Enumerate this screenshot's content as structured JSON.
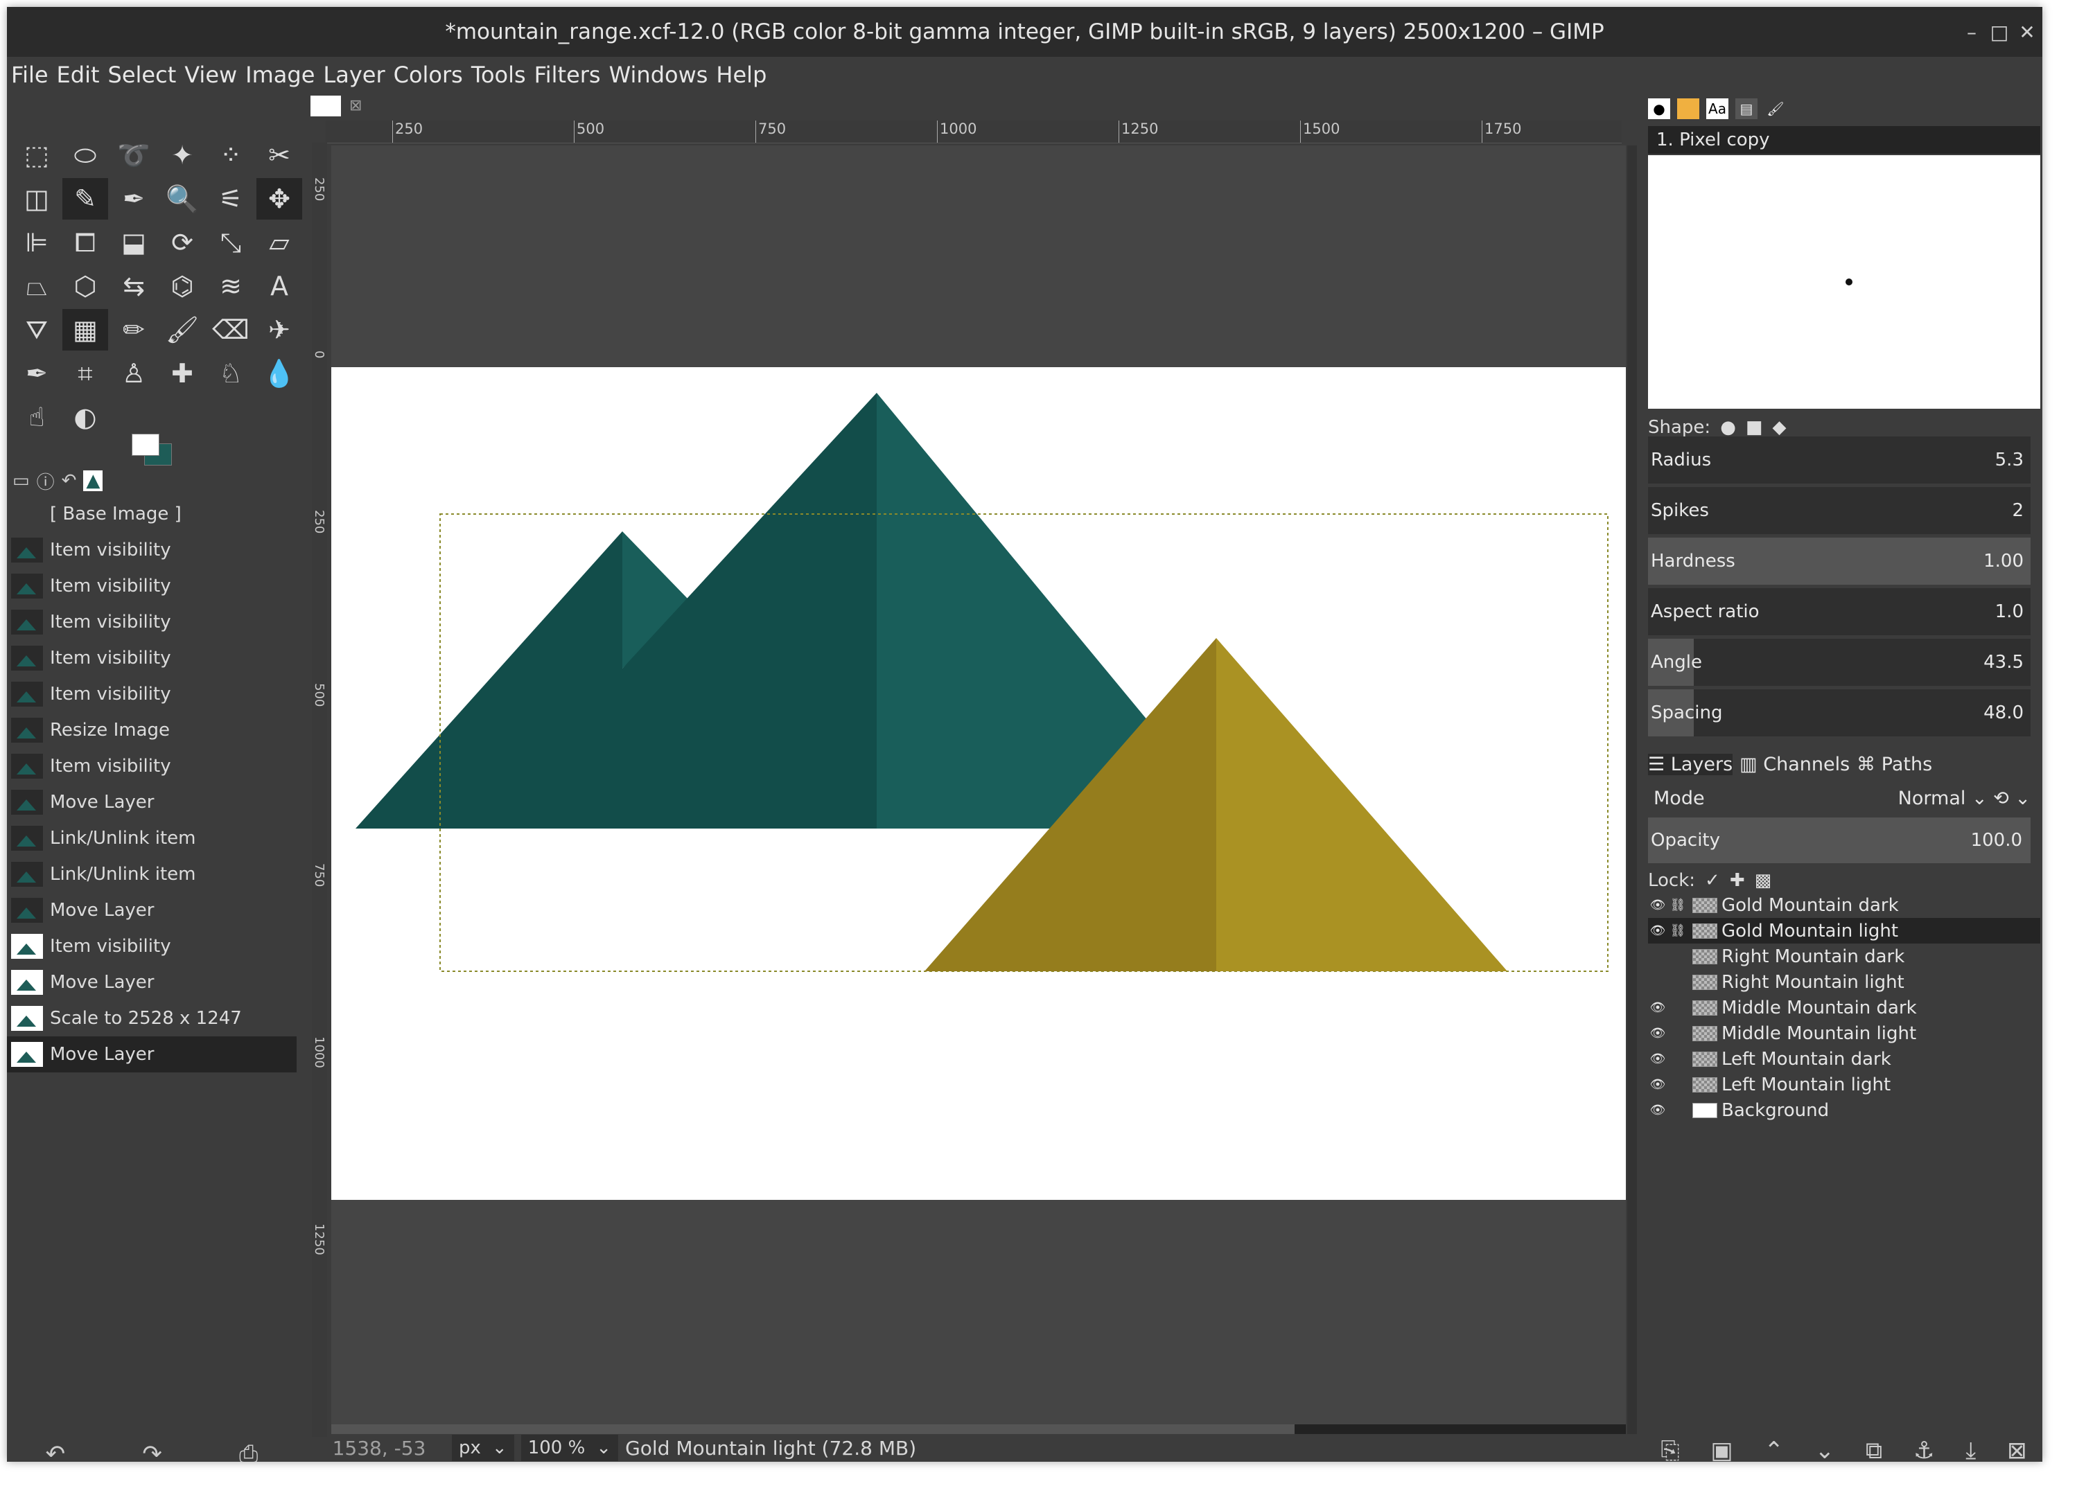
{
  "window": {
    "title": "*mountain_range.xcf-12.0 (RGB color 8-bit gamma integer, GIMP built-in sRGB, 9 layers) 2500x1200 – GIMP",
    "controls": {
      "minimize": "–",
      "maximize": "□",
      "close": "✕"
    }
  },
  "menu": [
    "File",
    "Edit",
    "Select",
    "View",
    "Image",
    "Layer",
    "Colors",
    "Tools",
    "Filters",
    "Windows",
    "Help"
  ],
  "tools": [
    "rect-select",
    "ellipse-select",
    "free-select",
    "fuzzy-select",
    "select-by-color",
    "scissors",
    "foreground-select",
    "paths",
    "color-picker",
    "zoom",
    "measure",
    "move",
    "align",
    "crop",
    "unified-transform",
    "rotate",
    "scale",
    "shear",
    "perspective",
    "3d-transform",
    "flip",
    "cage-transform",
    "warp-transform",
    "text",
    "bucket-fill",
    "gradient",
    "pencil",
    "paintbrush",
    "eraser",
    "airbrush",
    "ink",
    "mypaint-brush",
    "clone",
    "heal",
    "perspective-clone",
    "blur",
    "smudge",
    "dodge-burn"
  ],
  "undo_history": {
    "items": [
      {
        "label": "[ Base Image ]",
        "thumb": "none"
      },
      {
        "label": "Item visibility",
        "thumb": "mtn"
      },
      {
        "label": "Item visibility",
        "thumb": "mtn"
      },
      {
        "label": "Item visibility",
        "thumb": "mtn"
      },
      {
        "label": "Item visibility",
        "thumb": "mtn"
      },
      {
        "label": "Item visibility",
        "thumb": "mtn"
      },
      {
        "label": "Resize Image",
        "thumb": "mtn"
      },
      {
        "label": "Item visibility",
        "thumb": "mtn"
      },
      {
        "label": "Move Layer",
        "thumb": "mtn"
      },
      {
        "label": "Link/Unlink item",
        "thumb": "mtn"
      },
      {
        "label": "Link/Unlink item",
        "thumb": "mtn"
      },
      {
        "label": "Move Layer",
        "thumb": "mtn"
      },
      {
        "label": "Item visibility",
        "thumb": "img"
      },
      {
        "label": "Move Layer",
        "thumb": "img"
      },
      {
        "label": "Scale to 2528 x 1247",
        "thumb": "img"
      },
      {
        "label": "Move Layer",
        "thumb": "img",
        "selected": true
      }
    ]
  },
  "ruler": {
    "h_ticks": [
      "250",
      "500",
      "750",
      "1000",
      "1250",
      "1500",
      "1750"
    ],
    "v_ticks": [
      "250",
      "0",
      "250",
      "500",
      "750",
      "1000",
      "1250"
    ]
  },
  "status": {
    "coords": "1538, -53",
    "unit": "px",
    "zoom": "100 %",
    "layer_info": "Gold Mountain light (72.8 MB)"
  },
  "brushes": {
    "selected_name": "1. Pixel copy",
    "shape_label": "Shape:",
    "params": [
      {
        "label": "Radius",
        "value": "5.3",
        "fill": 0.0
      },
      {
        "label": "Spikes",
        "value": "2",
        "fill": 0.0
      },
      {
        "label": "Hardness",
        "value": "1.00",
        "fill": 1.0
      },
      {
        "label": "Aspect ratio",
        "value": "1.0",
        "fill": 0.0
      },
      {
        "label": "Angle",
        "value": "43.5",
        "fill": 0.12
      },
      {
        "label": "Spacing",
        "value": "48.0",
        "fill": 0.12
      }
    ]
  },
  "layers_panel": {
    "tabs": [
      "Layers",
      "Channels",
      "Paths"
    ],
    "mode_label": "Mode",
    "mode_value": "Normal",
    "opacity_label": "Opacity",
    "opacity_value": "100.0",
    "lock_label": "Lock:",
    "layers": [
      {
        "name": "Gold Mountain dark",
        "visible": true,
        "linked": true
      },
      {
        "name": "Gold Mountain light",
        "visible": true,
        "linked": true,
        "selected": true
      },
      {
        "name": "Right Mountain dark",
        "visible": false,
        "linked": false
      },
      {
        "name": "Right Mountain light",
        "visible": false,
        "linked": false
      },
      {
        "name": "Middle Mountain dark",
        "visible": true,
        "linked": false
      },
      {
        "name": "Middle Mountain light",
        "visible": true,
        "linked": false
      },
      {
        "name": "Left Mountain dark",
        "visible": true,
        "linked": false
      },
      {
        "name": "Left Mountain light",
        "visible": true,
        "linked": false
      },
      {
        "name": "Background",
        "visible": true,
        "linked": false,
        "white": true
      }
    ]
  },
  "colors": {
    "teal_dark": "#124d4a",
    "teal_light": "#195e5a",
    "gold_dark": "#957d1d",
    "gold_light": "#aa9223",
    "selection_outline": "#8a8a2a"
  }
}
